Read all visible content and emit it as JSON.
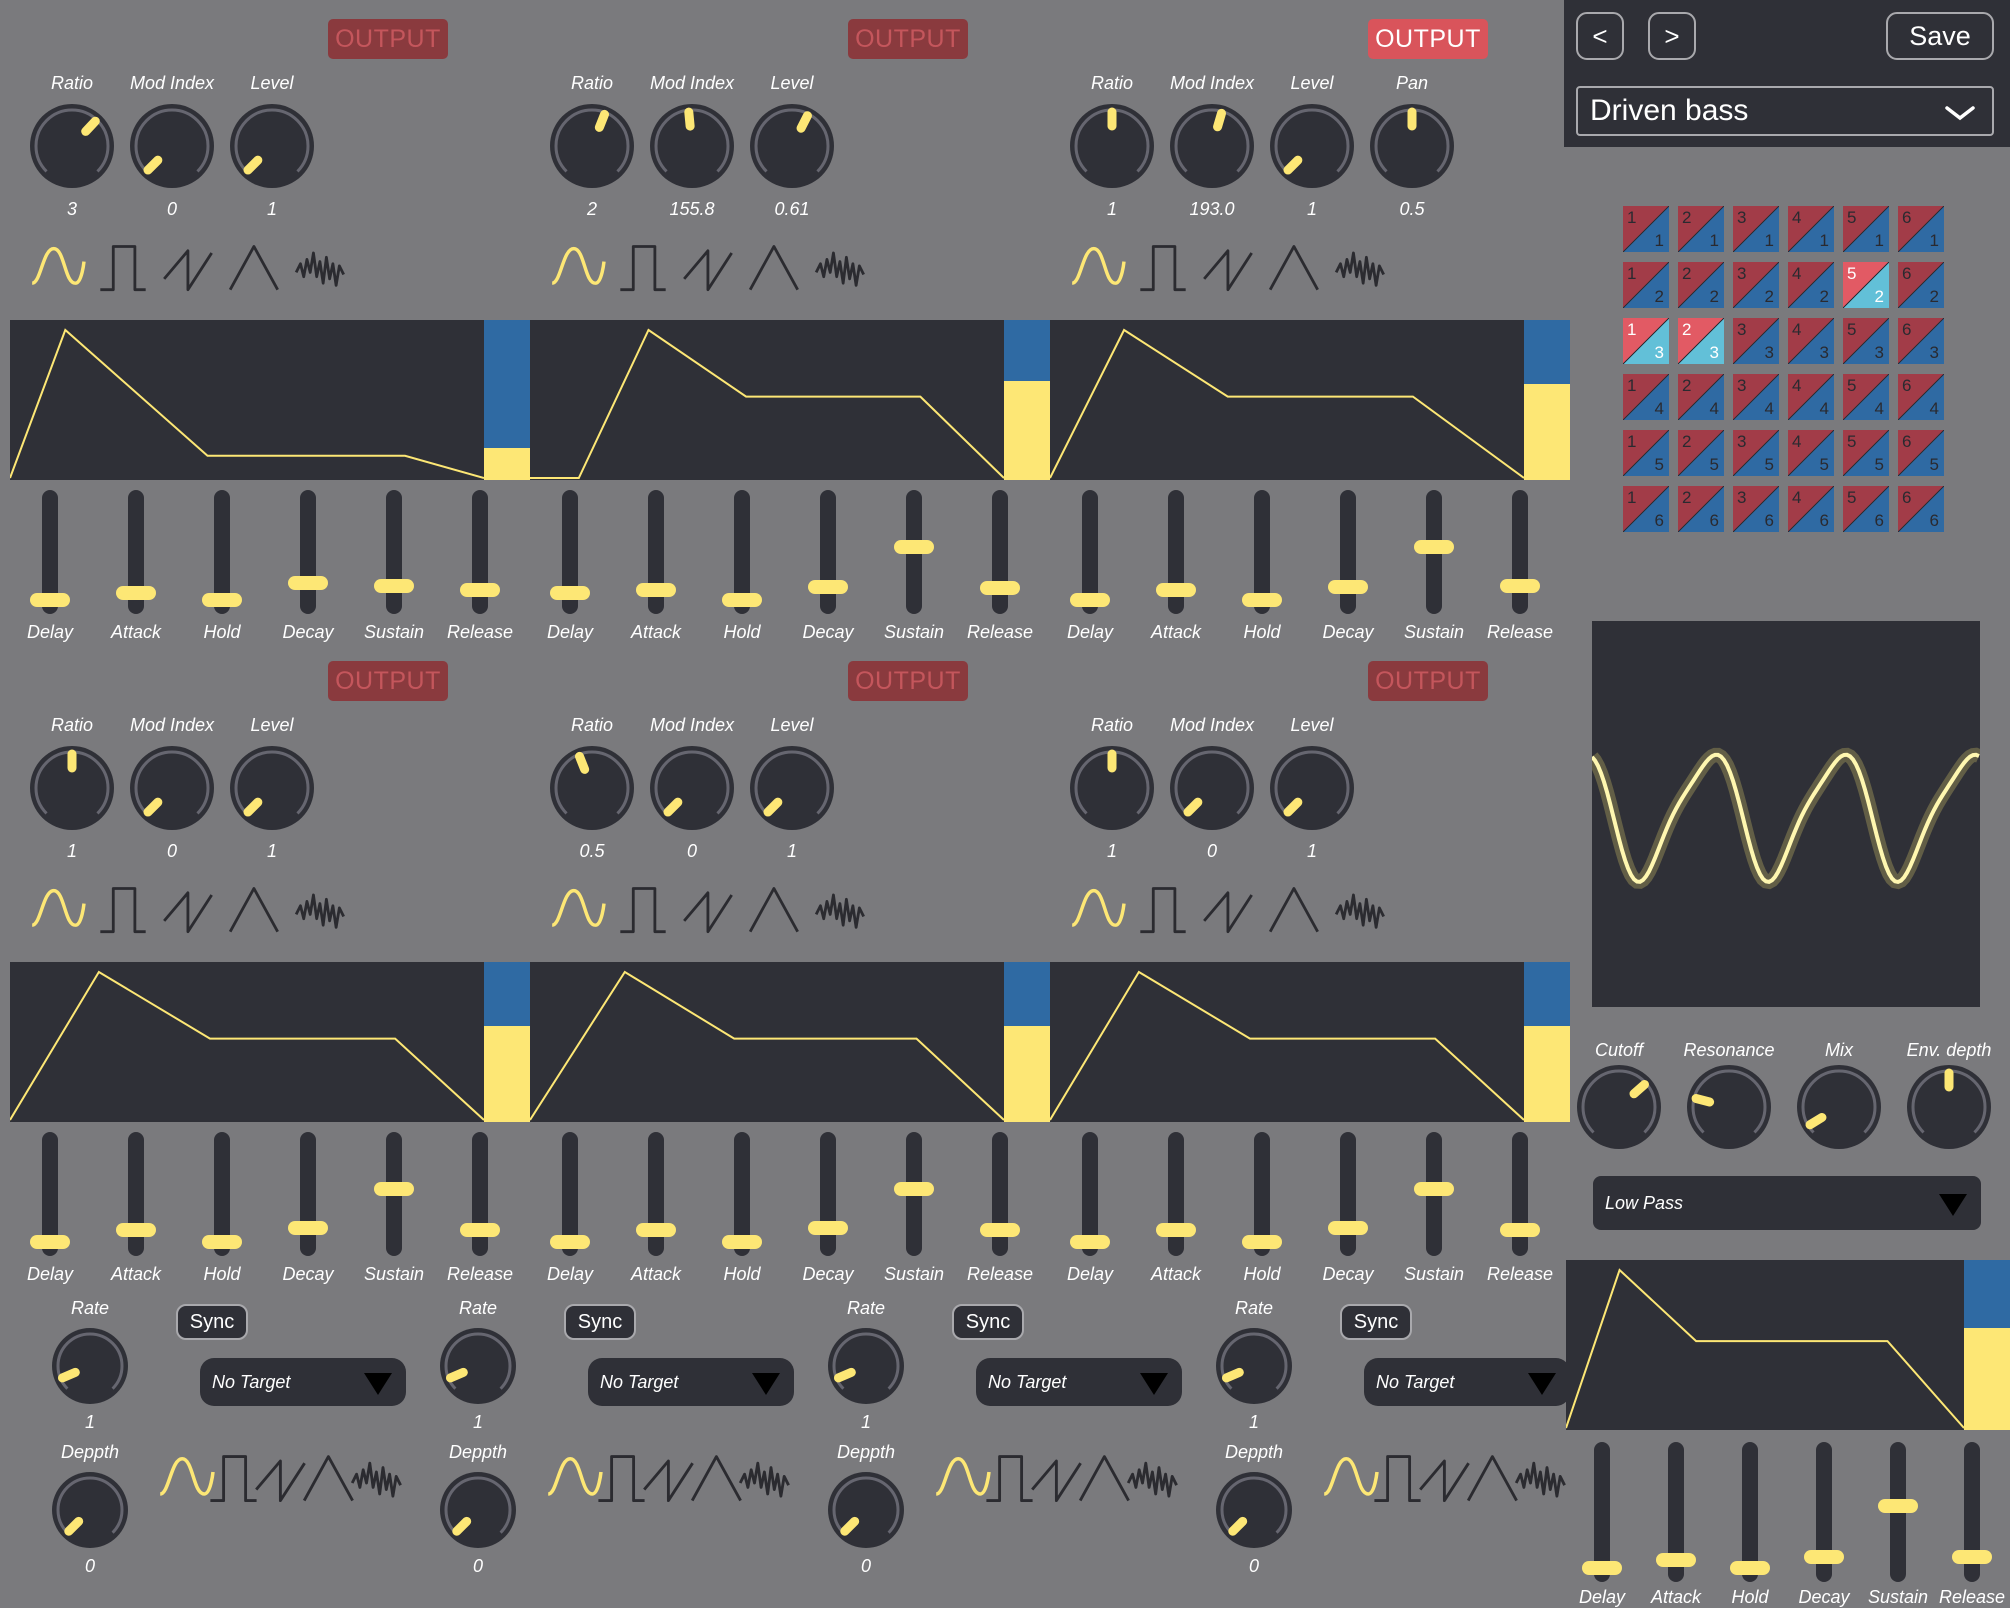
{
  "header": {
    "prev_label": "<",
    "next_label": ">",
    "save_label": "Save",
    "preset_name": "Driven bass"
  },
  "colors": {
    "background": "#7a7a7d",
    "panel_dark": "#2f3037",
    "accent_yellow": "#fde775",
    "matrix_blue": "#2f6aa3",
    "matrix_red": "#a23c48",
    "matrix_active_red": "#e25a64",
    "matrix_active_blue": "#62c0d8",
    "output_button_off": "#8a3a3e",
    "output_button_on": "#d9545b"
  },
  "operators": [
    {
      "output_label": "OUTPUT",
      "output_active": false,
      "knobs": [
        {
          "label": "Ratio",
          "value": "3",
          "level": 0.66
        },
        {
          "label": "Mod Index",
          "value": "0",
          "level": 0
        },
        {
          "label": "Level",
          "value": "1",
          "level": 0
        }
      ],
      "waveforms": [
        {
          "icon": "sine-wave-icon",
          "selected": true
        },
        {
          "icon": "square-wave-icon",
          "selected": false
        },
        {
          "icon": "saw-wave-icon",
          "selected": false
        },
        {
          "icon": "triangle-wave-icon",
          "selected": false
        },
        {
          "icon": "noise-wave-icon",
          "selected": false
        }
      ],
      "envelope": {
        "delay": 0.0,
        "attack": 0.07,
        "hold": 0.0,
        "decay": 0.18,
        "sustain": 0.15,
        "release": 0.1
      },
      "level_meter": 0.2
    },
    {
      "output_label": "OUTPUT",
      "output_active": false,
      "knobs": [
        {
          "label": "Ratio",
          "value": "2",
          "level": 0.58
        },
        {
          "label": "Mod Index",
          "value": "155.8",
          "level": 0.48
        },
        {
          "label": "Level",
          "value": "0.61",
          "level": 0.6
        }
      ],
      "waveforms": [
        {
          "icon": "sine-wave-icon",
          "selected": true
        },
        {
          "icon": "square-wave-icon",
          "selected": false
        },
        {
          "icon": "saw-wave-icon",
          "selected": false
        },
        {
          "icon": "triangle-wave-icon",
          "selected": false
        },
        {
          "icon": "noise-wave-icon",
          "selected": false
        }
      ],
      "envelope": {
        "delay": 0.07,
        "attack": 0.1,
        "hold": 0.0,
        "decay": 0.14,
        "sustain": 0.55,
        "release": 0.12
      },
      "level_meter": 0.62
    },
    {
      "output_label": "OUTPUT",
      "output_active": true,
      "knobs": [
        {
          "label": "Ratio",
          "value": "1",
          "level": 0.5
        },
        {
          "label": "Mod Index",
          "value": "193.0",
          "level": 0.56
        },
        {
          "label": "Level",
          "value": "1",
          "level": 0
        },
        {
          "label": "Pan",
          "value": "0.5",
          "level": 0.5
        }
      ],
      "waveforms": [
        {
          "icon": "sine-wave-icon",
          "selected": true
        },
        {
          "icon": "square-wave-icon",
          "selected": false
        },
        {
          "icon": "saw-wave-icon",
          "selected": false
        },
        {
          "icon": "triangle-wave-icon",
          "selected": false
        },
        {
          "icon": "noise-wave-icon",
          "selected": false
        }
      ],
      "envelope": {
        "delay": 0.0,
        "attack": 0.1,
        "hold": 0.0,
        "decay": 0.14,
        "sustain": 0.55,
        "release": 0.15
      },
      "level_meter": 0.6
    },
    {
      "output_label": "OUTPUT",
      "output_active": false,
      "knobs": [
        {
          "label": "Ratio",
          "value": "1",
          "level": 0.5
        },
        {
          "label": "Mod Index",
          "value": "0",
          "level": 0
        },
        {
          "label": "Level",
          "value": "1",
          "level": 0
        }
      ],
      "waveforms": [
        {
          "icon": "sine-wave-icon",
          "selected": true
        },
        {
          "icon": "square-wave-icon",
          "selected": false
        },
        {
          "icon": "saw-wave-icon",
          "selected": false
        },
        {
          "icon": "triangle-wave-icon",
          "selected": false
        },
        {
          "icon": "noise-wave-icon",
          "selected": false
        }
      ],
      "envelope": {
        "delay": 0.0,
        "attack": 0.12,
        "hold": 0.0,
        "decay": 0.15,
        "sustain": 0.55,
        "release": 0.12
      },
      "level_meter": 0.6
    },
    {
      "output_label": "OUTPUT",
      "output_active": false,
      "knobs": [
        {
          "label": "Ratio",
          "value": "0.5",
          "level": 0.42
        },
        {
          "label": "Mod Index",
          "value": "0",
          "level": 0
        },
        {
          "label": "Level",
          "value": "1",
          "level": 0
        }
      ],
      "waveforms": [
        {
          "icon": "sine-wave-icon",
          "selected": true
        },
        {
          "icon": "square-wave-icon",
          "selected": false
        },
        {
          "icon": "saw-wave-icon",
          "selected": false
        },
        {
          "icon": "triangle-wave-icon",
          "selected": false
        },
        {
          "icon": "noise-wave-icon",
          "selected": false
        }
      ],
      "envelope": {
        "delay": 0.0,
        "attack": 0.13,
        "hold": 0.0,
        "decay": 0.15,
        "sustain": 0.55,
        "release": 0.12
      },
      "level_meter": 0.6
    },
    {
      "output_label": "OUTPUT",
      "output_active": false,
      "knobs": [
        {
          "label": "Ratio",
          "value": "1",
          "level": 0.5
        },
        {
          "label": "Mod Index",
          "value": "0",
          "level": 0
        },
        {
          "label": "Level",
          "value": "1",
          "level": 0
        }
      ],
      "waveforms": [
        {
          "icon": "sine-wave-icon",
          "selected": true
        },
        {
          "icon": "square-wave-icon",
          "selected": false
        },
        {
          "icon": "saw-wave-icon",
          "selected": false
        },
        {
          "icon": "triangle-wave-icon",
          "selected": false
        },
        {
          "icon": "noise-wave-icon",
          "selected": false
        }
      ],
      "envelope": {
        "delay": 0.0,
        "attack": 0.12,
        "hold": 0.0,
        "decay": 0.15,
        "sustain": 0.55,
        "release": 0.12
      },
      "level_meter": 0.6
    }
  ],
  "envelope_labels": [
    "Delay",
    "Attack",
    "Hold",
    "Decay",
    "Sustain",
    "Release"
  ],
  "lfos": [
    {
      "rate_label": "Rate",
      "rate_value": "1",
      "rate_level": 0.08,
      "sync_label": "Sync",
      "target": "No Target",
      "depth_label": "Deppth",
      "depth_value": "0",
      "depth_level": 0
    },
    {
      "rate_label": "Rate",
      "rate_value": "1",
      "rate_level": 0.08,
      "sync_label": "Sync",
      "target": "No Target",
      "depth_label": "Deppth",
      "depth_value": "0",
      "depth_level": 0
    },
    {
      "rate_label": "Rate",
      "rate_value": "1",
      "rate_level": 0.08,
      "sync_label": "Sync",
      "target": "No Target",
      "depth_label": "Deppth",
      "depth_value": "0",
      "depth_level": 0
    },
    {
      "rate_label": "Rate",
      "rate_value": "1",
      "rate_level": 0.08,
      "sync_label": "Sync",
      "target": "No Target",
      "depth_label": "Deppth",
      "depth_value": "0",
      "depth_level": 0
    }
  ],
  "mod_matrix": {
    "rows": 6,
    "cols": 6,
    "active": [
      {
        "row": 2,
        "col": 5
      },
      {
        "row": 3,
        "col": 1
      },
      {
        "row": 3,
        "col": 2
      }
    ]
  },
  "filter": {
    "knobs": [
      {
        "label": "Cutoff",
        "level": 0.68
      },
      {
        "label": "Resonance",
        "level": 0.22
      },
      {
        "label": "Mix",
        "level": 0.05
      },
      {
        "label": "Env. depth",
        "level": 0.5
      }
    ],
    "type": "Low Pass",
    "envelope": {
      "delay": 0.0,
      "attack": 0.07,
      "hold": 0.0,
      "decay": 0.1,
      "sustain": 0.55,
      "release": 0.1
    },
    "level_meter": 0.6
  }
}
